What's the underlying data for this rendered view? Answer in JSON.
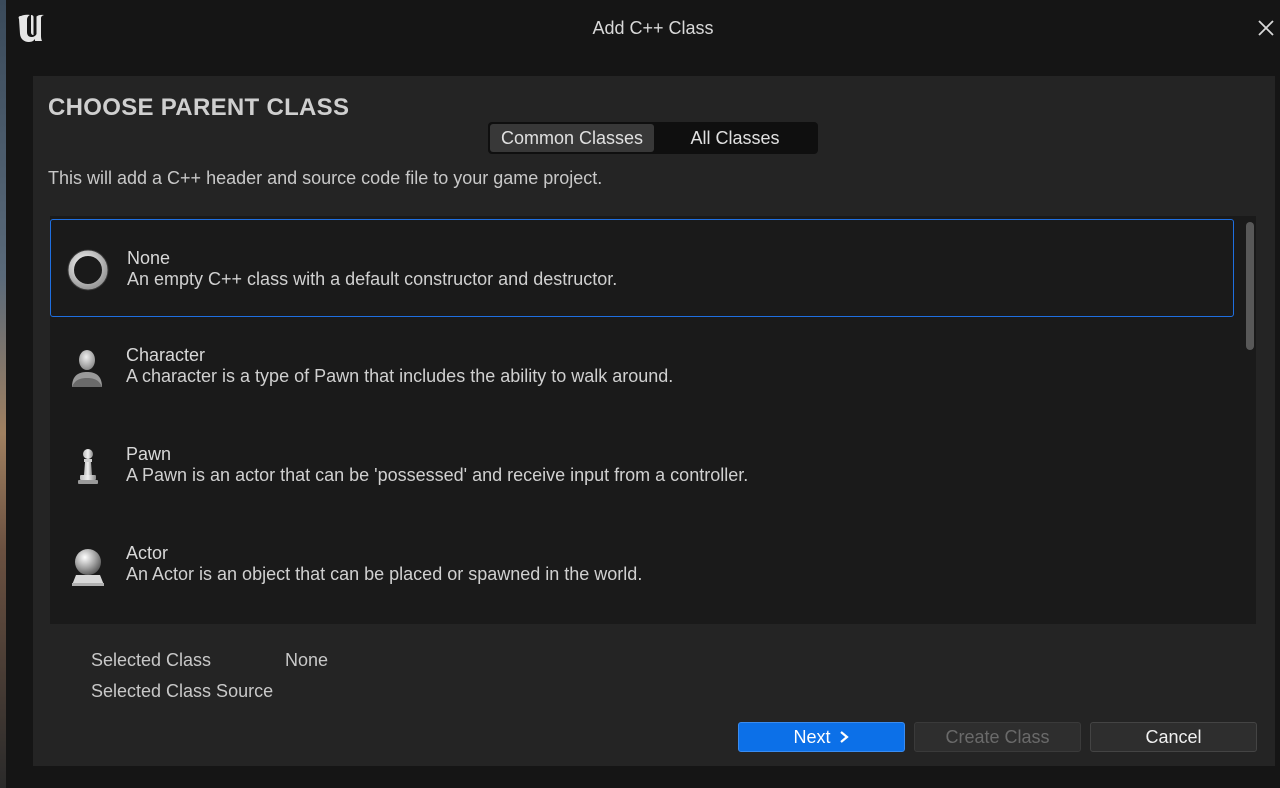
{
  "window": {
    "title": "Add C++ Class"
  },
  "header": {
    "heading": "CHOOSE PARENT CLASS",
    "description": "This will add a C++ header and source code file to your game project."
  },
  "tabs": [
    {
      "label": "Common Classes",
      "active": true
    },
    {
      "label": "All Classes",
      "active": false
    }
  ],
  "classes": [
    {
      "name": "None",
      "description": "An empty C++ class with a default constructor and destructor.",
      "icon": "ring-icon",
      "selected": true
    },
    {
      "name": "Character",
      "description": "A character is a type of Pawn that includes the ability to walk around.",
      "icon": "character-icon",
      "selected": false
    },
    {
      "name": "Pawn",
      "description": "A Pawn is an actor that can be 'possessed' and receive input from a controller.",
      "icon": "pawn-icon",
      "selected": false
    },
    {
      "name": "Actor",
      "description": "An Actor is an object that can be placed or spawned in the world.",
      "icon": "sphere-icon",
      "selected": false
    }
  ],
  "selection": {
    "selected_class_label": "Selected Class",
    "selected_class_value": "None",
    "selected_source_label": "Selected Class Source",
    "selected_source_value": ""
  },
  "buttons": {
    "next": "Next",
    "create": "Create Class",
    "cancel": "Cancel"
  },
  "colors": {
    "accent": "#0c70e8",
    "selection_border": "#1f6fe0",
    "panel": "#242424",
    "background": "#151515"
  }
}
